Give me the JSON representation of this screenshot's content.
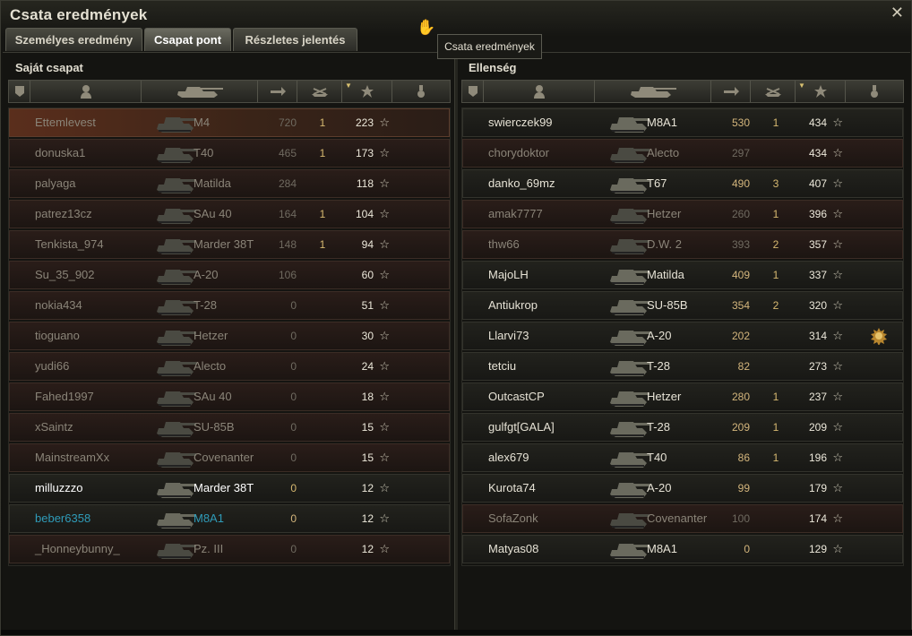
{
  "window": {
    "title": "Csata eredmények",
    "close": "✕"
  },
  "tabs": [
    {
      "label": "Személyes eredmény",
      "active": false
    },
    {
      "label": "Csapat pont",
      "active": true
    },
    {
      "label": "Részletes jelentés",
      "active": false
    }
  ],
  "tooltip": "Csata eredmények",
  "icons": {
    "squad": "squad-icon",
    "player": "player-icon",
    "tank": "tank-icon",
    "damage": "damage-icon",
    "kills": "kills-icon",
    "xp": "star-icon",
    "medal": "medal-icon"
  },
  "colors": {
    "self": "#ffffff",
    "platoon": "#2f9bb8",
    "dead": "#8a8478",
    "alive": "#e6e2d5",
    "damage": "#d3b57c",
    "highlight": "#5a2e1c"
  },
  "left": {
    "title": "Saját csapat",
    "players": [
      {
        "name": "Ettemlevest",
        "tank": "M4",
        "damage": "720",
        "kills": "1",
        "xp": "223",
        "status": "dead",
        "highlight": true
      },
      {
        "name": "donuska1",
        "tank": "T40",
        "damage": "465",
        "kills": "1",
        "xp": "173",
        "status": "dead"
      },
      {
        "name": "palyaga",
        "tank": "Matilda",
        "damage": "284",
        "kills": "",
        "xp": "118",
        "status": "dead"
      },
      {
        "name": "patrez13cz",
        "tank": "SAu 40",
        "damage": "164",
        "kills": "1",
        "xp": "104",
        "status": "dead"
      },
      {
        "name": "Tenkista_974",
        "tank": "Marder 38T",
        "damage": "148",
        "kills": "1",
        "xp": "94",
        "status": "dead"
      },
      {
        "name": "Su_35_902",
        "tank": "A-20",
        "damage": "106",
        "kills": "",
        "xp": "60",
        "status": "dead"
      },
      {
        "name": "nokia434",
        "tank": "T-28",
        "damage": "0",
        "kills": "",
        "xp": "51",
        "status": "dead"
      },
      {
        "name": "tioguano",
        "tank": "Hetzer",
        "damage": "0",
        "kills": "",
        "xp": "30",
        "status": "dead"
      },
      {
        "name": "yudi66",
        "tank": "Alecto",
        "damage": "0",
        "kills": "",
        "xp": "24",
        "status": "dead"
      },
      {
        "name": "Fahed1997",
        "tank": "SAu 40",
        "damage": "0",
        "kills": "",
        "xp": "18",
        "status": "dead"
      },
      {
        "name": "xSaintz",
        "tank": "SU-85B",
        "damage": "0",
        "kills": "",
        "xp": "15",
        "status": "dead"
      },
      {
        "name": "MainstreamXx",
        "tank": "Covenanter",
        "damage": "0",
        "kills": "",
        "xp": "15",
        "status": "dead"
      },
      {
        "name": "milluzzzo",
        "tank": "Marder 38T",
        "damage": "0",
        "kills": "",
        "xp": "12",
        "status": "self"
      },
      {
        "name": "beber6358",
        "tank": "M8A1",
        "damage": "0",
        "kills": "",
        "xp": "12",
        "status": "platoon"
      },
      {
        "name": "_Honneybunny_",
        "tank": "Pz. III",
        "damage": "0",
        "kills": "",
        "xp": "12",
        "status": "dead"
      }
    ]
  },
  "right": {
    "title": "Ellenség",
    "players": [
      {
        "name": "swierczek99",
        "tank": "M8A1",
        "damage": "530",
        "kills": "1",
        "xp": "434",
        "status": "alive"
      },
      {
        "name": "chorydoktor",
        "tank": "Alecto",
        "damage": "297",
        "kills": "",
        "xp": "434",
        "status": "dead"
      },
      {
        "name": "danko_69mz",
        "tank": "T67",
        "damage": "490",
        "kills": "3",
        "xp": "407",
        "status": "alive"
      },
      {
        "name": "amak7777",
        "tank": "Hetzer",
        "damage": "260",
        "kills": "1",
        "xp": "396",
        "status": "dead"
      },
      {
        "name": "thw66",
        "tank": "D.W. 2",
        "damage": "393",
        "kills": "2",
        "xp": "357",
        "status": "dead"
      },
      {
        "name": "MajoLH",
        "tank": "Matilda",
        "damage": "409",
        "kills": "1",
        "xp": "337",
        "status": "alive"
      },
      {
        "name": "Antiukrop",
        "tank": "SU-85B",
        "damage": "354",
        "kills": "2",
        "xp": "320",
        "status": "alive"
      },
      {
        "name": "Llarvi73",
        "tank": "A-20",
        "damage": "202",
        "kills": "",
        "xp": "314",
        "status": "alive",
        "medal": true
      },
      {
        "name": "tetciu",
        "tank": "T-28",
        "damage": "82",
        "kills": "",
        "xp": "273",
        "status": "alive"
      },
      {
        "name": "OutcastCP",
        "tank": "Hetzer",
        "damage": "280",
        "kills": "1",
        "xp": "237",
        "status": "alive"
      },
      {
        "name": "gulfgt[GALA]",
        "tank": "T-28",
        "damage": "209",
        "kills": "1",
        "xp": "209",
        "status": "alive"
      },
      {
        "name": "alex679",
        "tank": "T40",
        "damage": "86",
        "kills": "1",
        "xp": "196",
        "status": "alive"
      },
      {
        "name": "Kurota74",
        "tank": "A-20",
        "damage": "99",
        "kills": "",
        "xp": "179",
        "status": "alive"
      },
      {
        "name": "SofaZonk",
        "tank": "Covenanter",
        "damage": "100",
        "kills": "",
        "xp": "174",
        "status": "dead"
      },
      {
        "name": "Matyas08",
        "tank": "M8A1",
        "damage": "0",
        "kills": "",
        "xp": "129",
        "status": "alive"
      }
    ]
  }
}
